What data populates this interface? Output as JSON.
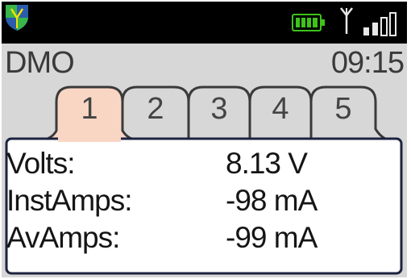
{
  "status_bar": {
    "logo_icon": "shield-logo-icon",
    "battery_icon": "battery-full-icon",
    "antenna_icon": "antenna-icon",
    "signal_icon": "signal-strength-icon",
    "battery_color": "#3ec31b",
    "shield_colors": {
      "green": "#39b54a",
      "blue": "#2b5cab",
      "yellow": "#f3e300"
    }
  },
  "header": {
    "mode": "DMO",
    "time": "09:15"
  },
  "tabs": [
    {
      "label": "1",
      "active": true
    },
    {
      "label": "2",
      "active": false
    },
    {
      "label": "3",
      "active": false
    },
    {
      "label": "4",
      "active": false
    },
    {
      "label": "5",
      "active": false
    }
  ],
  "readings": [
    {
      "label": "Volts:",
      "value": "8.13 V"
    },
    {
      "label": "InstAmps:",
      "value": "-98 mA"
    },
    {
      "label": "AvAmps:",
      "value": "-99 mA"
    }
  ],
  "colors": {
    "active_tab": "#f9d6c4",
    "inactive_tab": "#d7d7d7",
    "panel_border": "#1c2340",
    "screen_bg": "#d7d7d7"
  }
}
